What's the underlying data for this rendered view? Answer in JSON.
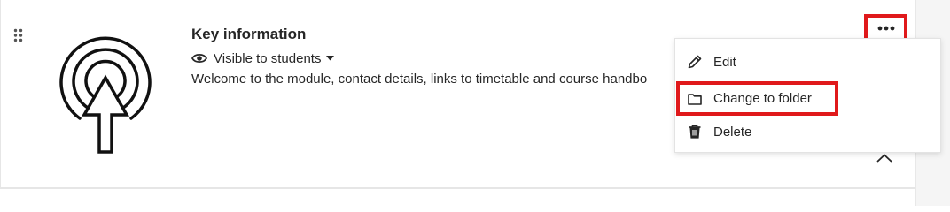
{
  "colors": {
    "highlight_red": "#e0191b",
    "text": "#262626",
    "border": "#e6e6e6"
  },
  "item": {
    "title": "Key information",
    "visibility": "Visible to students",
    "description": "Welcome to the module, contact details, links to timetable and course handbo",
    "icon": "target-pointer-icon"
  },
  "actions": {
    "more_icon": "more-options-icon",
    "collapse_icon": "chevron-up-icon",
    "drag_icon": "drag-handle-icon"
  },
  "menu": {
    "items": [
      {
        "label": "Edit",
        "icon": "pencil-icon"
      },
      {
        "label": "Change to folder",
        "icon": "folder-icon"
      },
      {
        "label": "Delete",
        "icon": "trash-icon"
      }
    ]
  }
}
